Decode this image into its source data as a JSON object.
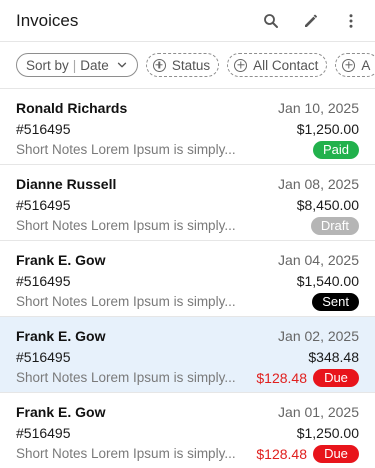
{
  "header": {
    "title": "Invoices",
    "icons": [
      "search-icon",
      "pencil-icon",
      "more-vertical-icon"
    ]
  },
  "filters": {
    "sort_label": "Sort by",
    "sort_value": "Date",
    "chips": [
      "Status",
      "All Contact",
      "A"
    ]
  },
  "colors": {
    "paid": "#22b14c",
    "draft": "#b5b5b5",
    "sent": "#000000",
    "due": "#e8141b",
    "selected_row": "#e7f1fb"
  },
  "invoices": [
    {
      "name": "Ronald Richards",
      "date": "Jan 10, 2025",
      "number": "#516495",
      "amount": "$1,250.00",
      "notes": "Short Notes Lorem Ipsum is simply...",
      "status": "Paid",
      "due_amount": ""
    },
    {
      "name": "Dianne Russell",
      "date": "Jan 08, 2025",
      "number": "#516495",
      "amount": "$8,450.00",
      "notes": "Short Notes Lorem Ipsum is simply...",
      "status": "Draft",
      "due_amount": ""
    },
    {
      "name": "Frank E. Gow",
      "date": "Jan 04, 2025",
      "number": "#516495",
      "amount": "$1,540.00",
      "notes": "Short Notes Lorem Ipsum is simply...",
      "status": "Sent",
      "due_amount": ""
    },
    {
      "name": "Frank E. Gow",
      "date": "Jan 02, 2025",
      "number": "#516495",
      "amount": "$348.48",
      "notes": "Short Notes Lorem Ipsum is simply...",
      "status": "Due",
      "due_amount": "$128.48"
    },
    {
      "name": "Frank E. Gow",
      "date": "Jan 01, 2025",
      "number": "#516495",
      "amount": "$1,250.00",
      "notes": "Short Notes Lorem Ipsum is simply...",
      "status": "Due",
      "due_amount": "$128.48"
    }
  ]
}
